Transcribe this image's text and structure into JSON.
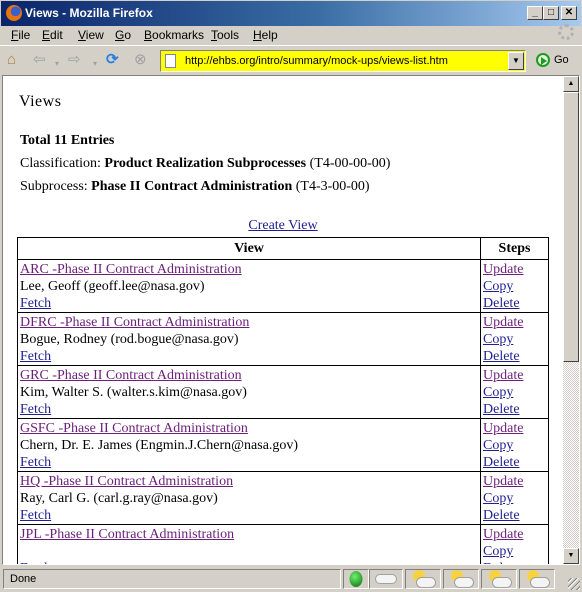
{
  "window": {
    "title": "Views - Mozilla Firefox",
    "controls": {
      "minimize": "_",
      "maximize": "□",
      "close": "✕"
    }
  },
  "menubar": {
    "items": [
      {
        "label": "File",
        "accel": "F"
      },
      {
        "label": "Edit",
        "accel": "E"
      },
      {
        "label": "View",
        "accel": "V"
      },
      {
        "label": "Go",
        "accel": "G"
      },
      {
        "label": "Bookmarks",
        "accel": "B"
      },
      {
        "label": "Tools",
        "accel": "T"
      },
      {
        "label": "Help",
        "accel": "H"
      }
    ]
  },
  "navbar": {
    "icons": [
      "home-icon",
      "back-icon",
      "forward-icon",
      "reload-icon",
      "stop-icon"
    ],
    "url": "http://ehbs.org/intro/summary/mock-ups/views-list.htm",
    "go_label": "Go"
  },
  "page": {
    "heading": "Views",
    "total": "Total 11 Entries",
    "classification_label": "Classification: ",
    "classification_value": "Product Realization Subprocesses",
    "classification_code": " (T4-00-00-00)",
    "subprocess_label": "Subprocess: ",
    "subprocess_value": "Phase II Contract Administration",
    "subprocess_code": " (T4-3-00-00)",
    "create_view": "Create View",
    "table": {
      "headers": {
        "view": "View",
        "steps": "Steps"
      },
      "rows": [
        {
          "title": "ARC -Phase II Contract Administration",
          "owner": "Lee, Geoff (geoff.lee@nasa.gov)",
          "fetch": "Fetch",
          "update": "Update",
          "copy": "Copy",
          "delete": "Delete"
        },
        {
          "title": "DFRC -Phase II Contract Administration",
          "owner": "Bogue, Rodney (rod.bogue@nasa.gov)",
          "fetch": "Fetch",
          "update": "Update",
          "copy": "Copy",
          "delete": "Delete"
        },
        {
          "title": "GRC -Phase II Contract Administration",
          "owner": "Kim, Walter S. (walter.s.kim@nasa.gov)",
          "fetch": "Fetch",
          "update": "Update",
          "copy": "Copy",
          "delete": "Delete"
        },
        {
          "title": "GSFC -Phase II Contract Administration",
          "owner": "Chern, Dr. E. James (Engmin.J.Chern@nasa.gov)",
          "fetch": "Fetch",
          "update": "Update",
          "copy": "Copy",
          "delete": "Delete"
        },
        {
          "title": "HQ -Phase II Contract Administration",
          "owner": "Ray, Carl G. (carl.g.ray@nasa.gov)",
          "fetch": "Fetch",
          "update": "Update",
          "copy": "Copy",
          "delete": "Delete"
        },
        {
          "title": "JPL -Phase II Contract Administration",
          "owner": "",
          "fetch": "Fetch",
          "update": "Update",
          "copy": "Copy",
          "delete": "Delete"
        }
      ]
    }
  },
  "statusbar": {
    "text": "Done",
    "icons": [
      "status-green-icon",
      "cloud-icon",
      "sun-cloud-icon",
      "sun-cloud-icon",
      "sun-cloud-icon",
      "sun-cloud-icon"
    ]
  }
}
